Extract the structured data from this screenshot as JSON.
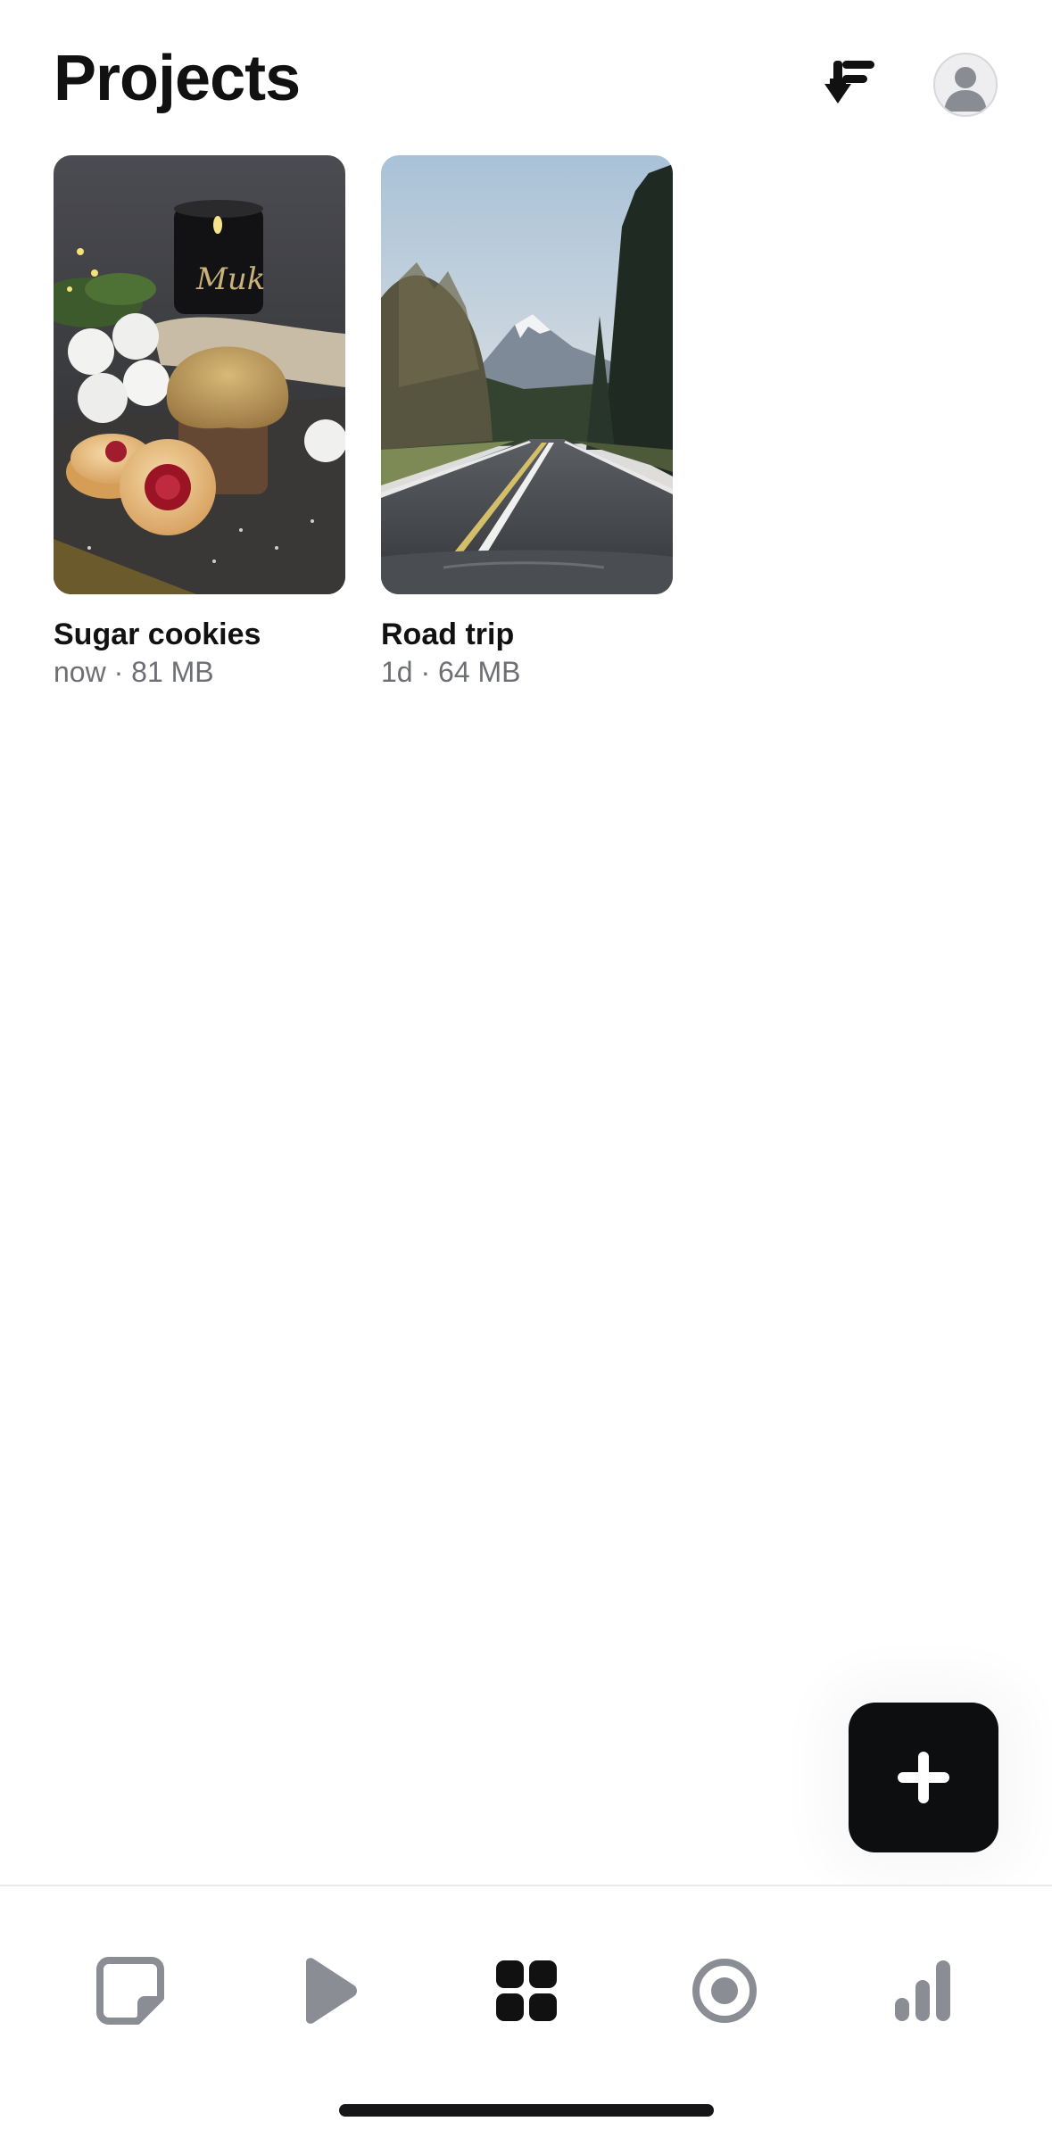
{
  "header": {
    "title": "Projects",
    "sort_icon": "sort-download-icon",
    "avatar_icon": "user-avatar-icon"
  },
  "projects": [
    {
      "title": "Sugar cookies",
      "meta": "now · 81 MB",
      "thumbnail": "sugar-cookies-thumbnail"
    },
    {
      "title": "Road trip",
      "meta": "1d · 64 MB",
      "thumbnail": "road-trip-thumbnail"
    }
  ],
  "fab": {
    "icon": "plus-icon"
  },
  "tabbar": {
    "tabs": [
      {
        "icon": "note-icon",
        "active": false
      },
      {
        "icon": "play-icon",
        "active": false
      },
      {
        "icon": "grid-icon",
        "active": true
      },
      {
        "icon": "record-icon",
        "active": false
      },
      {
        "icon": "bar-chart-icon",
        "active": false
      }
    ]
  },
  "colors": {
    "text": "#111111",
    "meta": "#6e6f75",
    "inactive_tab": "#8b8d94",
    "active_tab": "#111111",
    "fab": "#0d0e10"
  }
}
